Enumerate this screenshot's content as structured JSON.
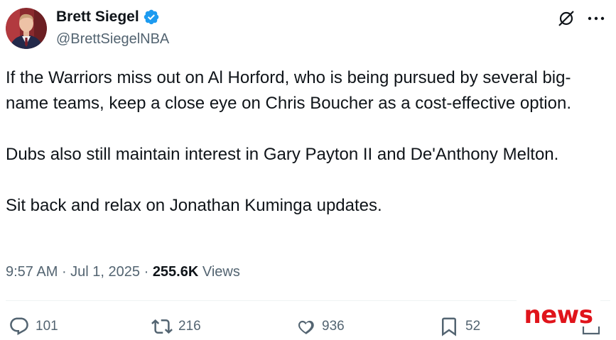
{
  "author": {
    "display_name": "Brett Siegel",
    "handle": "@BrettSiegelNBA",
    "verified": true
  },
  "tweet": {
    "paragraphs": [
      "If the Warriors miss out on Al Horford, who is being pursued by several big-name teams, keep a close eye on Chris Boucher as a cost-effective option.",
      "Dubs also still maintain interest in Gary Payton II and De'Anthony Melton.",
      "Sit back and relax on Jonathan Kuminga updates."
    ]
  },
  "meta": {
    "time": "9:57 AM",
    "separator1": " · ",
    "date": "Jul 1, 2025",
    "separator2": " · ",
    "views_count": "255.6K",
    "views_label": " Views"
  },
  "actions": {
    "replies": "101",
    "reposts": "216",
    "likes": "936",
    "bookmarks": "52"
  },
  "watermark": "news",
  "colors": {
    "verified_blue": "#1d9bf0",
    "secondary_text": "#536471",
    "watermark_red": "#e0141b"
  }
}
